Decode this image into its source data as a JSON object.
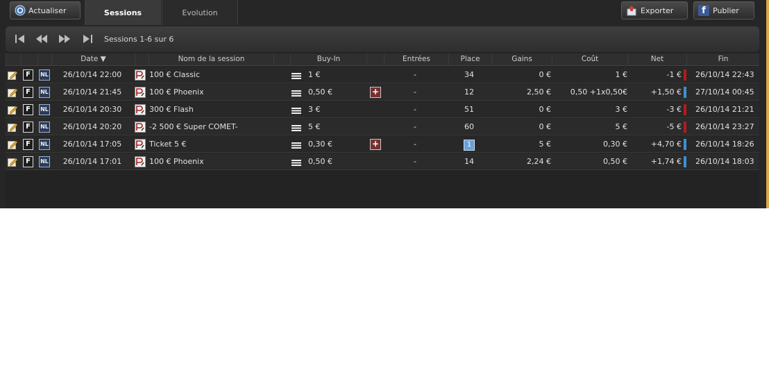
{
  "toolbar": {
    "refresh_label": "Actualiser",
    "export_label": "Exporter",
    "publish_label": "Publier"
  },
  "tabs": [
    {
      "label": "Sessions",
      "active": true
    },
    {
      "label": "Evolution",
      "active": false
    }
  ],
  "pager": {
    "text": "Sessions 1-6 sur 6"
  },
  "table": {
    "headers": {
      "date": "Date ▼",
      "name": "Nom de la session",
      "buyin": "Buy-In",
      "entrees": "Entrées",
      "place": "Place",
      "gains": "Gains",
      "cout": "Coût",
      "net": "Net",
      "fin": "Fin"
    },
    "rows": [
      {
        "date": "26/10/14 22:00",
        "name": "100 € Classic",
        "buyin": "1 €",
        "plus": false,
        "entrees": "-",
        "place": "34",
        "place_badge": false,
        "gains": "0 €",
        "cout": "1 €",
        "net": "-1 €",
        "net_color": "#b31b1b",
        "fin": "26/10/14 22:43"
      },
      {
        "date": "26/10/14 21:45",
        "name": "100 € Phoenix",
        "buyin": "0,50 €",
        "plus": true,
        "entrees": "-",
        "place": "12",
        "place_badge": false,
        "gains": "2,50 €",
        "cout": "0,50  +1x0,50€",
        "net": "+1,50 €",
        "net_color": "#3f8fd2",
        "fin": "27/10/14 00:45"
      },
      {
        "date": "26/10/14 20:30",
        "name": "300 € Flash",
        "buyin": "3 €",
        "plus": false,
        "entrees": "-",
        "place": "51",
        "place_badge": false,
        "gains": "0 €",
        "cout": "3 €",
        "net": "-3 €",
        "net_color": "#b31b1b",
        "fin": "26/10/14 21:21"
      },
      {
        "date": "26/10/14 20:20",
        "name": "-2 500 € Super COMET-",
        "buyin": "5 €",
        "plus": false,
        "entrees": "-",
        "place": "60",
        "place_badge": false,
        "gains": "0 €",
        "cout": "5 €",
        "net": "-5 €",
        "net_color": "#b31b1b",
        "fin": "26/10/14 23:27"
      },
      {
        "date": "26/10/14 17:05",
        "name": "Ticket 5 €",
        "buyin": "0,30 €",
        "plus": true,
        "entrees": "-",
        "place": "1",
        "place_badge": true,
        "gains": "5 €",
        "cout": "0,30 €",
        "net": "+4,70 €",
        "net_color": "#3f8fd2",
        "fin": "26/10/14 18:26"
      },
      {
        "date": "26/10/14 17:01",
        "name": "100 € Phoenix",
        "buyin": "0,50 €",
        "plus": false,
        "entrees": "-",
        "place": "14",
        "place_badge": false,
        "gains": "2,24 €",
        "cout": "0,50 €",
        "net": "+1,74 €",
        "net_color": "#3f8fd2",
        "fin": "26/10/14 18:03"
      }
    ]
  },
  "colors": {
    "background": "#262626",
    "accent_border": "#d8a94a",
    "loss": "#b31b1b",
    "profit": "#3f8fd2"
  }
}
